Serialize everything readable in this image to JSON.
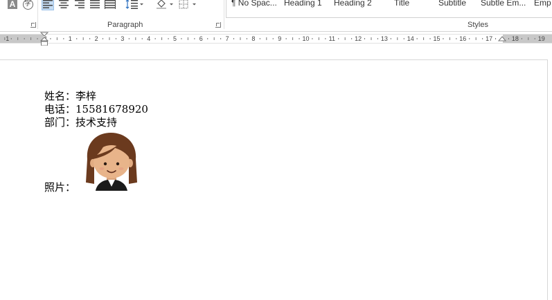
{
  "ribbon": {
    "paragraph_group_label": "Paragraph",
    "styles_group_label": "Styles",
    "styles": [
      "¶ No Spac...",
      "Heading 1",
      "Heading 2",
      "Title",
      "Subtitle",
      "Subtle Em...",
      "Emp"
    ],
    "font_buttons": {
      "text_effects_glyph": "A",
      "enclose_char_glyph": "字"
    }
  },
  "ruler": {
    "left_labels": [
      "1",
      "1"
    ],
    "labels": [
      "1",
      "2",
      "3",
      "4",
      "5",
      "6",
      "7",
      "8",
      "9",
      "10",
      "11",
      "12",
      "13",
      "14",
      "15",
      "16",
      "17",
      "18",
      "19"
    ]
  },
  "document": {
    "name_line": "姓名：李梓",
    "phone_line": "电话：15581678920",
    "dept_line": "部门：技术支持",
    "photo_label": "照片："
  },
  "colors": {
    "active_button_bg": "#c5dcf3",
    "hair": "#6b3a1e",
    "skin": "#e8b48a"
  }
}
